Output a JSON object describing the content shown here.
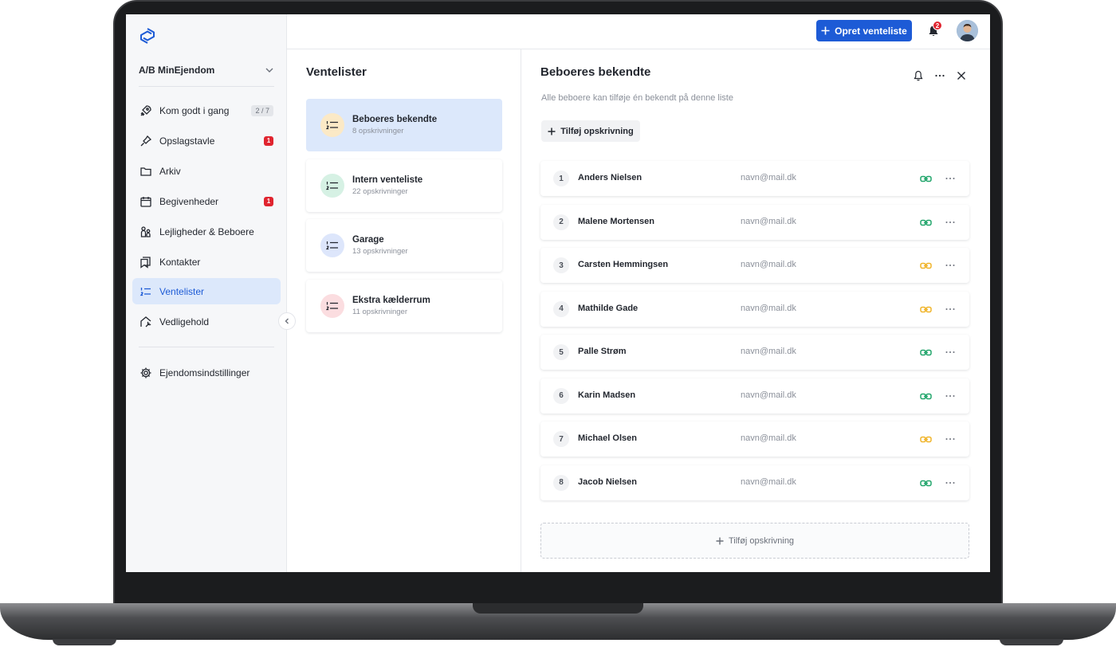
{
  "app": {
    "org_name": "A/B MinEjendom",
    "create_button": "Opret venteliste",
    "notification_count": "2",
    "accent_color": "#1d5bd6"
  },
  "sidebar": {
    "items": [
      {
        "label": "Kom godt i gang",
        "badge": "2 / 7",
        "icon": "rocket-icon"
      },
      {
        "label": "Opslagstavle",
        "badge": "1",
        "icon": "pin-icon"
      },
      {
        "label": "Arkiv",
        "badge": "",
        "icon": "folder-icon"
      },
      {
        "label": "Begivenheder",
        "badge": "1",
        "icon": "calendar-icon"
      },
      {
        "label": "Lejligheder & Beboere",
        "badge": "",
        "icon": "residents-icon"
      },
      {
        "label": "Kontakter",
        "badge": "",
        "icon": "contacts-icon"
      },
      {
        "label": "Ventelister",
        "badge": "",
        "icon": "numbered-list-icon",
        "active": true
      },
      {
        "label": "Vedligehold",
        "badge": "",
        "icon": "maintenance-icon"
      }
    ],
    "settings_label": "Ejendomsindstillinger"
  },
  "waitlists": {
    "title": "Ventelister",
    "items": [
      {
        "name": "Beboeres bekendte",
        "count": "8 opskrivninger",
        "color": "#fbe9c6",
        "active": true
      },
      {
        "name": "Intern venteliste",
        "count": "22 opskrivninger",
        "color": "#d6f1e4"
      },
      {
        "name": "Garage",
        "count": "13 opskrivninger",
        "color": "#dde6fb"
      },
      {
        "name": "Ekstra kælderrum",
        "count": "11 opskrivninger",
        "color": "#fbdde0"
      }
    ]
  },
  "detail": {
    "title": "Beboeres bekendte",
    "description": "Alle beboere kan tilføje én bekendt på denne liste",
    "add_label": "Tilføj opskrivning",
    "add_bottom_label": "Tilføj opskrivning",
    "rows": [
      {
        "num": "1",
        "name": "Anders Nielsen",
        "email": "navn@mail.dk",
        "link_status": "green"
      },
      {
        "num": "2",
        "name": "Malene Mortensen",
        "email": "navn@mail.dk",
        "link_status": "green"
      },
      {
        "num": "3",
        "name": "Carsten Hemmingsen",
        "email": "navn@mail.dk",
        "link_status": "yellow"
      },
      {
        "num": "4",
        "name": "Mathilde Gade",
        "email": "navn@mail.dk",
        "link_status": "yellow"
      },
      {
        "num": "5",
        "name": "Palle Strøm",
        "email": "navn@mail.dk",
        "link_status": "green"
      },
      {
        "num": "6",
        "name": "Karin Madsen",
        "email": "navn@mail.dk",
        "link_status": "green"
      },
      {
        "num": "7",
        "name": "Michael Olsen",
        "email": "navn@mail.dk",
        "link_status": "yellow"
      },
      {
        "num": "8",
        "name": "Jacob Nielsen",
        "email": "navn@mail.dk",
        "link_status": "green"
      }
    ],
    "status_colors": {
      "green": "#21a56b",
      "yellow": "#f0b429"
    }
  }
}
